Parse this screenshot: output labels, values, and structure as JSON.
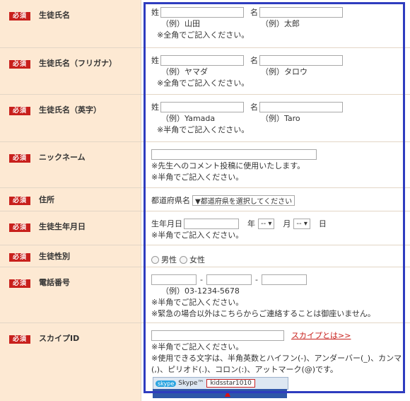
{
  "required_label": "必須",
  "rows": [
    {
      "label": "生徒氏名",
      "sei": "姓",
      "mei": "名",
      "ex_sei": "（例）山田",
      "ex_mei": "（例）太郎",
      "note": "※全角でご記入ください。"
    },
    {
      "label": "生徒氏名（フリガナ）",
      "sei": "姓",
      "mei": "名",
      "ex_sei": "（例）ヤマダ",
      "ex_mei": "（例）タロウ",
      "note": "※全角でご記入ください。"
    },
    {
      "label": "生徒氏名（英字）",
      "sei": "姓",
      "mei": "名",
      "ex_sei": "（例）Yamada",
      "ex_mei": "（例）Taro",
      "note": "※半角でご記入ください。"
    },
    {
      "label": "ニックネーム",
      "note1": "※先生へのコメント投稿に使用いたします。",
      "note2": "※半角でご記入ください。"
    },
    {
      "label": "住所",
      "prefix": "都道府県名",
      "select": "▼都道府県を選択してください"
    },
    {
      "label": "生徒生年月日",
      "year_label": "生年月日",
      "nen": "年",
      "month_sel": "--",
      "tsuki": "月",
      "day_sel": "--",
      "hi": "日",
      "note": "※半角でご記入ください。"
    },
    {
      "label": "生徒性別",
      "male": "男性",
      "female": "女性"
    },
    {
      "label": "電話番号",
      "dash": "-",
      "example": "（例）03-1234-5678",
      "note1": "※半角でご記入ください。",
      "note2": "※緊急の場合以外はこちらからご連絡することは御座いません。"
    },
    {
      "label": "スカイプID",
      "link": "スカイプとは>>",
      "note1": "※半角でご記入ください。",
      "note2": "※使用できる文字は、半角英数とハイフン(-)、アンダーバー(_)、カンマ",
      "note3": "(,)、ピリオド(.)、コロン(:)、アットマーク(@)です。"
    }
  ],
  "skype": {
    "logo": "skype",
    "brand": "Skype™",
    "user": "kidsstar1010"
  }
}
